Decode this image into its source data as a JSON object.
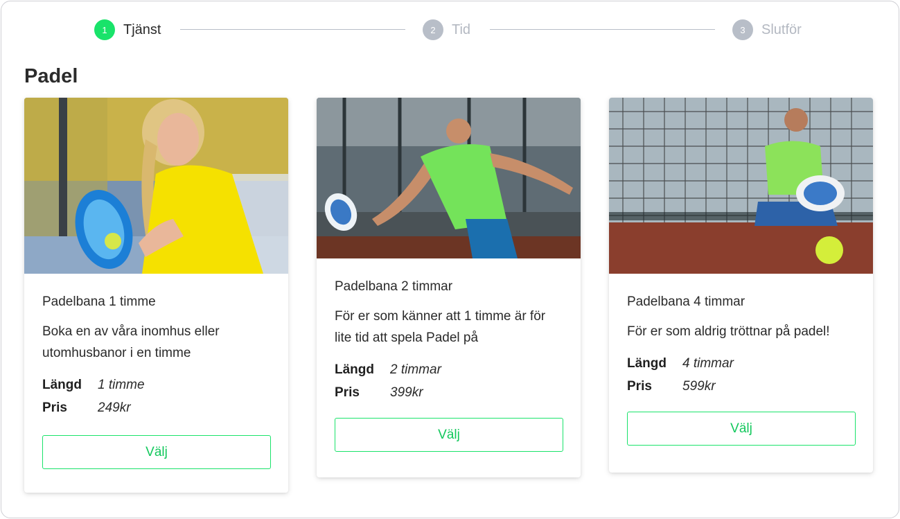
{
  "stepper": {
    "steps": [
      {
        "number": "1",
        "label": "Tjänst",
        "state": "active"
      },
      {
        "number": "2",
        "label": "Tid",
        "state": "inactive"
      },
      {
        "number": "3",
        "label": "Slutför",
        "state": "inactive"
      }
    ]
  },
  "category_title": "Padel",
  "colors": {
    "accent": "#19e36a",
    "inactive": "#b8bec8"
  },
  "cards": [
    {
      "image": "woman-yellow-shirt-holding-padel-racket-photo",
      "name": "Padelbana 1 timme",
      "description": "Boka en av våra inomhus eller utomhusbanor i en timme",
      "duration_label": "Längd",
      "duration_value": "1 timme",
      "price_label": "Pris",
      "price_value": "249kr",
      "button_label": "Välj"
    },
    {
      "image": "man-green-shirt-hitting-ball-photo",
      "name": "Padelbana 2 timmar",
      "description": "För er som känner att 1 timme är för lite tid att spela Padel på",
      "duration_label": "Längd",
      "duration_value": "2 timmar",
      "price_label": "Pris",
      "price_value": "399kr",
      "button_label": "Välj"
    },
    {
      "image": "man-sitting-by-net-photo",
      "name": "Padelbana 4 timmar",
      "description": "För er som aldrig tröttnar på padel!",
      "duration_label": "Längd",
      "duration_value": "4 timmar",
      "price_label": "Pris",
      "price_value": "599kr",
      "button_label": "Välj"
    }
  ]
}
